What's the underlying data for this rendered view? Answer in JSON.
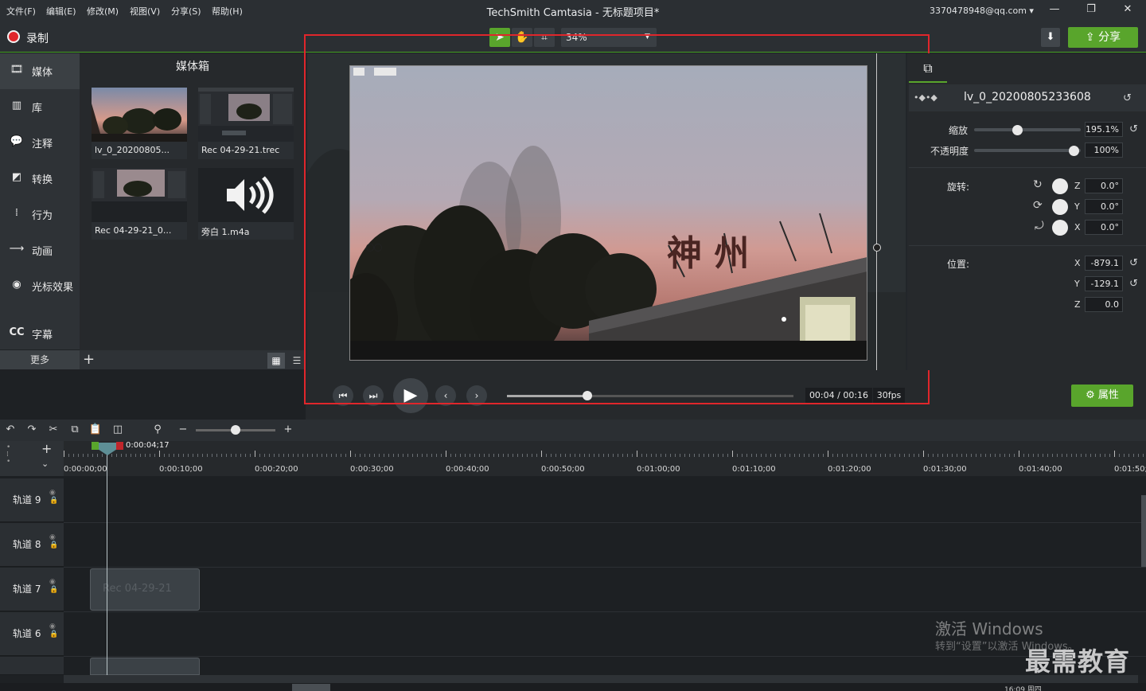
{
  "menu": [
    "文件(F)",
    "编辑(E)",
    "修改(M)",
    "视图(V)",
    "分享(S)",
    "帮助(H)"
  ],
  "app_title": "TechSmith Camtasia - 无标题项目*",
  "account": "3370478948@qq.com ▾",
  "window_controls": {
    "minimize": "—",
    "restore": "❐",
    "close": "✕"
  },
  "record_label": "录制",
  "zoom_level": "34%",
  "share_label": "分享",
  "nav": [
    {
      "label": "媒体",
      "icon": "film-icon"
    },
    {
      "label": "库",
      "icon": "library-icon"
    },
    {
      "label": "注释",
      "icon": "annotation-icon"
    },
    {
      "label": "转换",
      "icon": "transition-icon"
    },
    {
      "label": "行为",
      "icon": "behavior-icon"
    },
    {
      "label": "动画",
      "icon": "animation-icon"
    },
    {
      "label": "光标效果",
      "icon": "cursor-icon"
    },
    {
      "label": "字幕",
      "icon": "cc-icon"
    }
  ],
  "more_label": "更多",
  "media_bin": {
    "title": "媒体箱",
    "items": [
      {
        "label": "lv_0_20200805..."
      },
      {
        "label": "Rec 04-29-21.trec"
      },
      {
        "label": "Rec 04-29-21_0..."
      },
      {
        "label": "旁白 1.m4a"
      }
    ]
  },
  "video_sign_text": "神  州",
  "playback": {
    "time": "00:04 / 00:16",
    "fps": "30fps",
    "progress": 0.28
  },
  "properties_label": "属性",
  "properties": {
    "clip_name": "lv_0_20200805233608",
    "scale_label": "缩放",
    "scale_value": "195.1%",
    "scale_slider": 0.4,
    "opacity_label": "不透明度",
    "opacity_value": "100%",
    "opacity_slider": 1.0,
    "rotation_label": "旋转:",
    "rotation": [
      {
        "axis": "Z",
        "value": "0.0°"
      },
      {
        "axis": "Y",
        "value": "0.0°"
      },
      {
        "axis": "X",
        "value": "0.0°"
      }
    ],
    "position_label": "位置:",
    "position": [
      {
        "axis": "X",
        "value": "-879.1"
      },
      {
        "axis": "Y",
        "value": "-129.1"
      },
      {
        "axis": "Z",
        "value": "0.0"
      }
    ]
  },
  "timeline": {
    "playhead_time": "0:00:04;17",
    "ruler": [
      "0:00:00;00",
      "0:00:10;00",
      "0:00:20;00",
      "0:00:30;00",
      "0:00:40;00",
      "0:00:50;00",
      "0:01:00;00",
      "0:01:10;00",
      "0:01:20;00",
      "0:01:30;00",
      "0:01:40;00",
      "0:01:50;"
    ],
    "tracks": [
      "轨道 9",
      "轨道 8",
      "轨道 7",
      "轨道 6"
    ],
    "clip_label": "Rec 04-29-21"
  },
  "watermark": {
    "line1": "激活 Windows",
    "line2": "转到“设置”以激活 Windows。"
  },
  "brand": "最需教育",
  "clock_snippet": "16:09 周四"
}
